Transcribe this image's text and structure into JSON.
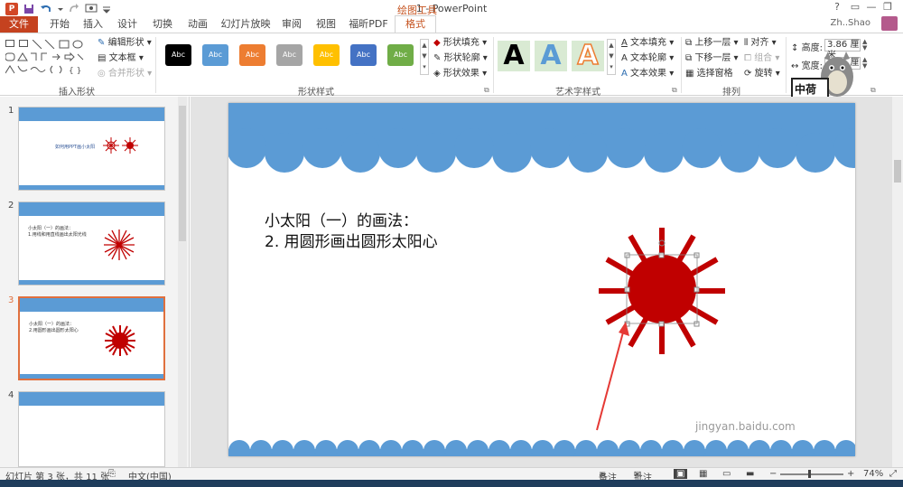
{
  "title_bar": {
    "window_title": "1 - PowerPoint",
    "tools_label": "绘图工具",
    "app_icon": "P",
    "quick_access": [
      "save-icon",
      "undo-icon",
      "redo-icon",
      "present-icon",
      "customize-icon"
    ]
  },
  "tabs": [
    "文件",
    "开始",
    "插入",
    "设计",
    "切换",
    "动画",
    "幻灯片放映",
    "审阅",
    "视图",
    "福昕PDF",
    "格式"
  ],
  "user": {
    "name": "Zh..Shao"
  },
  "ribbon": {
    "insert_shapes": {
      "label": "插入形状",
      "edit_shape": "编辑形状",
      "text_box": "文本框",
      "merge_shapes": "合并形状"
    },
    "shape_styles": {
      "label": "形状样式",
      "swatch_text": "Abc",
      "swatches": [
        "#000000",
        "#5b9bd5",
        "#ed7d31",
        "#a5a5a5",
        "#ffc000",
        "#4472c4",
        "#70ad47"
      ],
      "fill": "形状填充",
      "outline": "形状轮廓",
      "effects": "形状效果"
    },
    "wordart": {
      "label": "艺术字样式",
      "sample": "A",
      "text_fill": "文本填充",
      "text_outline": "文本轮廓",
      "text_effects": "文本效果"
    },
    "arrange": {
      "label": "排列",
      "bring_forward": "上移一层",
      "send_backward": "下移一层",
      "selection_pane": "选择窗格",
      "align": "对齐",
      "group": "组合",
      "rotate": "旋转"
    },
    "size": {
      "height_label": "高度:",
      "height_value": "3.86 厘米",
      "width_label": "宽度:",
      "width_value": "3.86 厘米"
    },
    "sticker_text": "中荷"
  },
  "thumbnails": [
    {
      "num": "1",
      "lines": [
        "如何用PPT画小太阳"
      ]
    },
    {
      "num": "2",
      "lines": [
        "小太阳（一）的画法：",
        "1.用线和用直线画出太阳光线"
      ]
    },
    {
      "num": "3",
      "lines": [
        "小太阳（一）的画法：",
        "2.用圆形画出圆形太阳心"
      ]
    },
    {
      "num": "4",
      "lines": []
    }
  ],
  "slide": {
    "line1": "小太阳（一）的画法：",
    "line2": "2. 用圆形画出圆形太阳心"
  },
  "watermark": "jingyan.baidu.com",
  "status": {
    "slide_info": "幻灯片 第 3 张，共 11 张",
    "language": "中文(中国)",
    "notes": "备注",
    "comments": "批注",
    "zoom": "74%"
  },
  "colors": {
    "accent": "#c5421f",
    "sun": "#c00000",
    "cloud": "#5b9bd5",
    "selected_thumb_border": "#e0703e"
  }
}
